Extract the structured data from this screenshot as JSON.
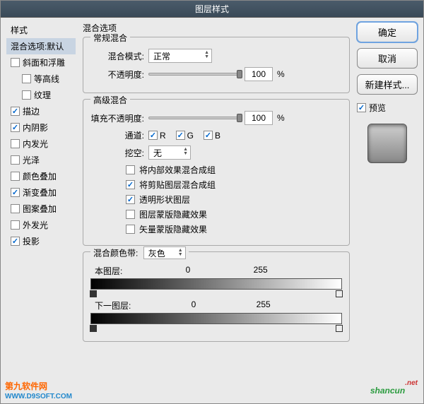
{
  "title": "图层样式",
  "sidebar": {
    "header": "样式",
    "selected": "混合选项:默认",
    "items": [
      {
        "label": "斜面和浮雕",
        "checked": false,
        "sub": false
      },
      {
        "label": "等高线",
        "checked": false,
        "sub": true
      },
      {
        "label": "纹理",
        "checked": false,
        "sub": true
      },
      {
        "label": "描边",
        "checked": true,
        "sub": false
      },
      {
        "label": "内阴影",
        "checked": true,
        "sub": false
      },
      {
        "label": "内发光",
        "checked": false,
        "sub": false
      },
      {
        "label": "光泽",
        "checked": false,
        "sub": false
      },
      {
        "label": "颜色叠加",
        "checked": false,
        "sub": false
      },
      {
        "label": "渐变叠加",
        "checked": true,
        "sub": false
      },
      {
        "label": "图案叠加",
        "checked": false,
        "sub": false
      },
      {
        "label": "外发光",
        "checked": false,
        "sub": false
      },
      {
        "label": "投影",
        "checked": true,
        "sub": false
      }
    ]
  },
  "main": {
    "section_title": "混合选项",
    "general": {
      "title": "常规混合",
      "mode_label": "混合模式:",
      "mode_value": "正常",
      "opacity_label": "不透明度:",
      "opacity_value": "100",
      "opacity_unit": "%"
    },
    "advanced": {
      "title": "高级混合",
      "fill_label": "填充不透明度:",
      "fill_value": "100",
      "fill_unit": "%",
      "channel_label": "通道:",
      "channels": [
        {
          "label": "R",
          "checked": true
        },
        {
          "label": "G",
          "checked": true
        },
        {
          "label": "B",
          "checked": true
        }
      ],
      "knockout_label": "挖空:",
      "knockout_value": "无",
      "options": [
        {
          "label": "将内部效果混合成组",
          "checked": false
        },
        {
          "label": "将剪贴图层混合成组",
          "checked": true
        },
        {
          "label": "透明形状图层",
          "checked": true
        },
        {
          "label": "图层蒙版隐藏效果",
          "checked": false
        },
        {
          "label": "矢量蒙版隐藏效果",
          "checked": false
        }
      ]
    },
    "blendif": {
      "title": "混合颜色带:",
      "mode": "灰色",
      "this_layer": "本图层:",
      "next_layer": "下一图层:",
      "min": "0",
      "max": "255"
    }
  },
  "right": {
    "ok": "确定",
    "cancel": "取消",
    "newstyle": "新建样式...",
    "preview": "预览"
  },
  "watermarks": {
    "left_main": "第九软件网",
    "left_sub": "WWW.D9SOFT.COM",
    "right_text": "shancun",
    "right_suffix": ".net"
  }
}
